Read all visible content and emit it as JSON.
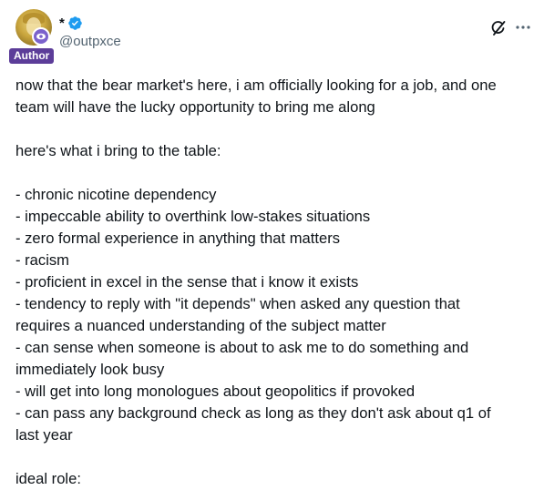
{
  "author": {
    "display_name": "*",
    "handle": "@outpxce",
    "badge": "Author",
    "verified": true,
    "avatar_icon": "avatar-image",
    "subscription_icon": "eye-icon"
  },
  "actions": {
    "grok_icon": "grok-icon",
    "more_icon": "more-icon"
  },
  "tweet": {
    "text": "now that the bear market's here, i am officially looking for a job, and one\nteam will have the lucky opportunity to bring me along\n\nhere's what i bring to the table:\n\n- chronic nicotine dependency\n- impeccable ability to overthink low-stakes situations\n- zero formal experience in anything that matters\n- racism\n- proficient in excel in the sense that i know it exists\n- tendency to reply with \"it depends\" when asked any question that\nrequires a nuanced understanding of the subject matter\n- can sense when someone is about to ask me to do something and\nimmediately look busy\n- will get into long monologues about geopolitics if provoked\n- can pass any background check as long as they don't ask about q1 of\nlast year\n\nideal role:"
  },
  "colors": {
    "verified_blue": "#1d9bf0",
    "author_badge": "#5c3d99",
    "subscription_badge": "#7b62cc",
    "secondary_text": "#536471"
  }
}
